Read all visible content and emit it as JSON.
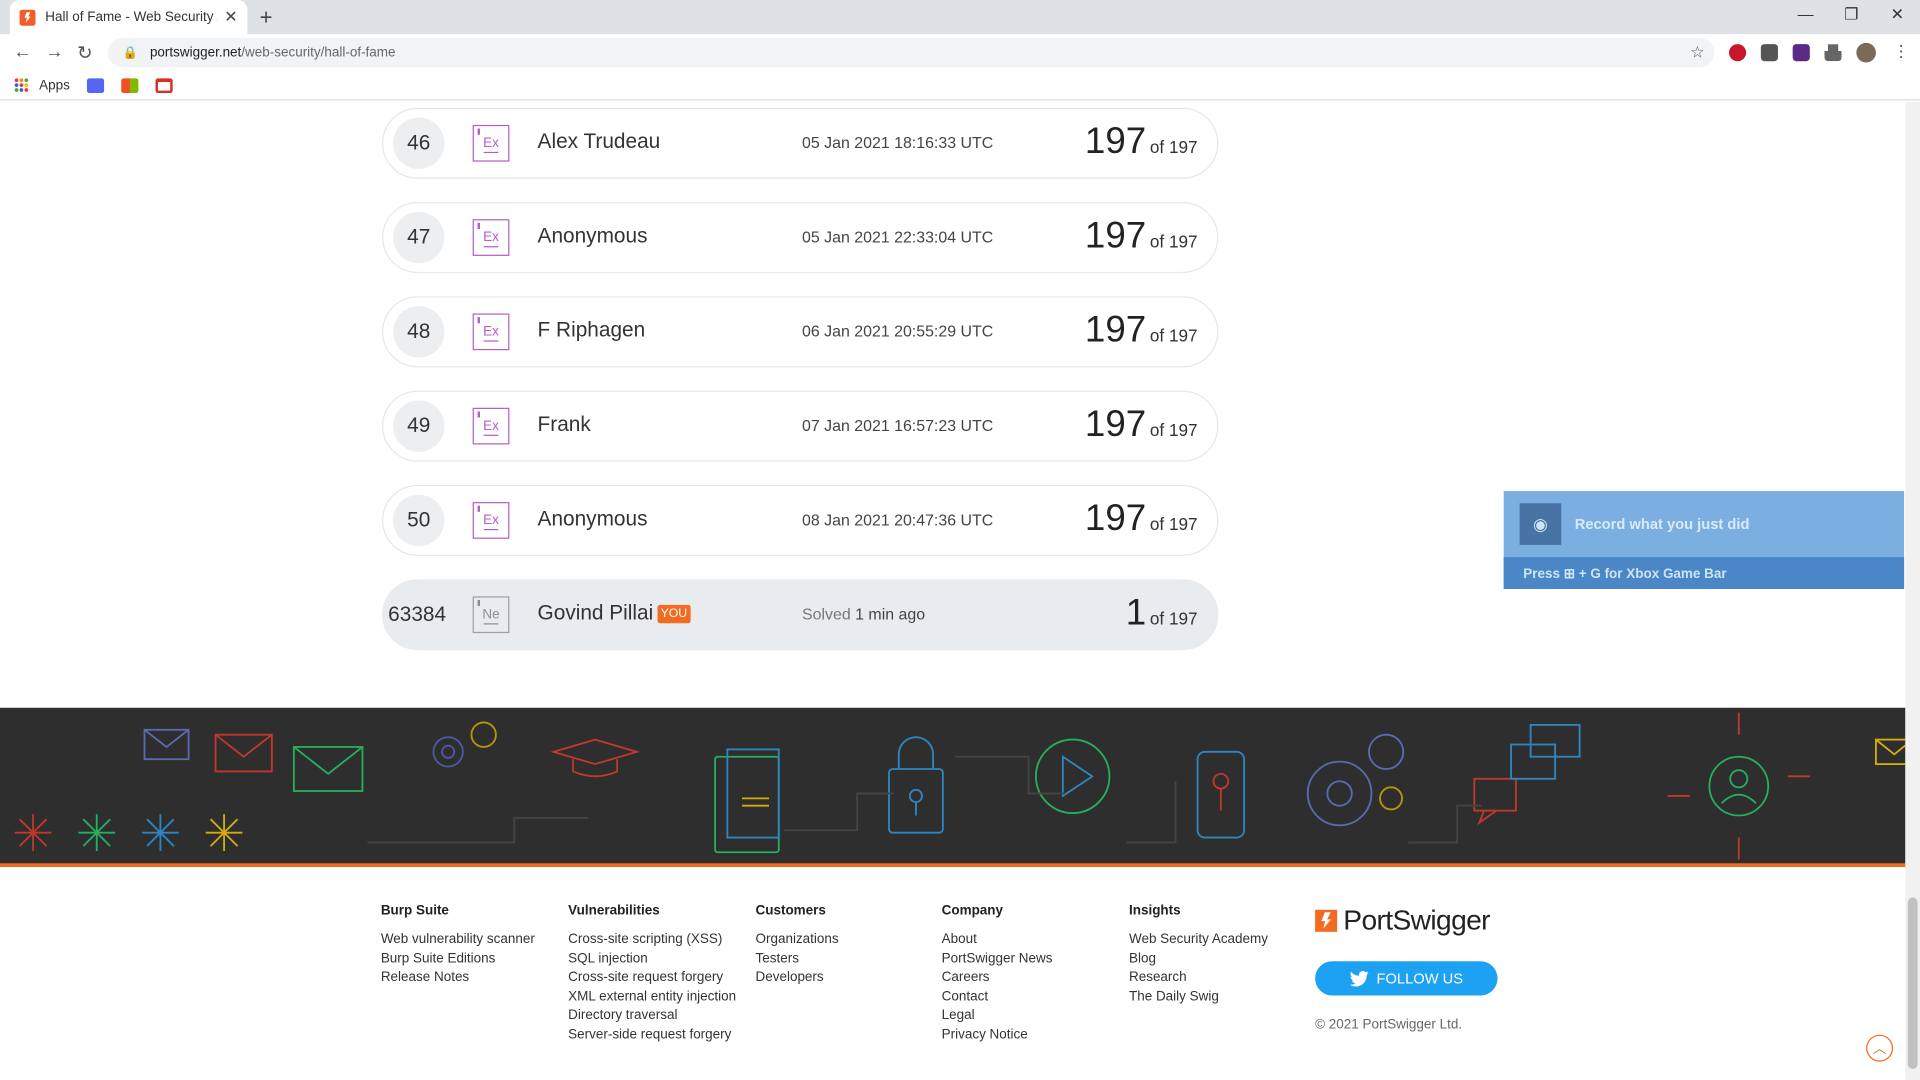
{
  "browser": {
    "tab_title": "Hall of Fame - Web Security Academy",
    "tab_close": "✕",
    "new_tab": "+",
    "url_host": "portswigger.net",
    "url_path": "/web-security/hall-of-fame",
    "bookmarks": {
      "apps_label": "Apps"
    },
    "window_controls": {
      "minimize": "—",
      "restore": "❐",
      "close": "✕"
    }
  },
  "leaderboard": {
    "rows": [
      {
        "rank": "46",
        "level": "Ex",
        "name": "Alex Trudeau",
        "date": "05 Jan 2021 18:16:33 UTC",
        "score": "197",
        "of": "of 197"
      },
      {
        "rank": "47",
        "level": "Ex",
        "name": "Anonymous",
        "date": "05 Jan 2021 22:33:04 UTC",
        "score": "197",
        "of": "of 197"
      },
      {
        "rank": "48",
        "level": "Ex",
        "name": "F Riphagen",
        "date": "06 Jan 2021 20:55:29 UTC",
        "score": "197",
        "of": "of 197"
      },
      {
        "rank": "49",
        "level": "Ex",
        "name": "Frank",
        "date": "07 Jan 2021 16:57:23 UTC",
        "score": "197",
        "of": "of 197"
      },
      {
        "rank": "50",
        "level": "Ex",
        "name": "Anonymous",
        "date": "08 Jan 2021 20:47:36 UTC",
        "score": "197",
        "of": "of 197"
      }
    ],
    "current_user": {
      "rank": "63384",
      "level": "Ne",
      "name": "Govind Pillai",
      "badge": "YOU",
      "solved_label": "Solved",
      "solved_time": "1 min ago",
      "score": "1",
      "of": "of 197"
    }
  },
  "xbox_overlay": {
    "title": "Record what you just did",
    "hint": "Press ⊞ + G for Xbox Game Bar"
  },
  "footer": {
    "columns": [
      {
        "heading": "Burp Suite",
        "links": [
          "Web vulnerability scanner",
          "Burp Suite Editions",
          "Release Notes"
        ]
      },
      {
        "heading": "Vulnerabilities",
        "links": [
          "Cross-site scripting (XSS)",
          "SQL injection",
          "Cross-site request forgery",
          "XML external entity injection",
          "Directory traversal",
          "Server-side request forgery"
        ]
      },
      {
        "heading": "Customers",
        "links": [
          "Organizations",
          "Testers",
          "Developers"
        ]
      },
      {
        "heading": "Company",
        "links": [
          "About",
          "PortSwigger News",
          "Careers",
          "Contact",
          "Legal",
          "Privacy Notice"
        ]
      },
      {
        "heading": "Insights",
        "links": [
          "Web Security Academy",
          "Blog",
          "Research",
          "The Daily Swig"
        ]
      }
    ],
    "brand": "PortSwigger",
    "follow_label": "FOLLOW US",
    "copyright": "© 2021 PortSwigger Ltd."
  },
  "colors": {
    "accent": "#f26b21",
    "expert_level": "#b45fc9",
    "twitter": "#1da1f2",
    "banner_bg": "#2e2e2e"
  }
}
